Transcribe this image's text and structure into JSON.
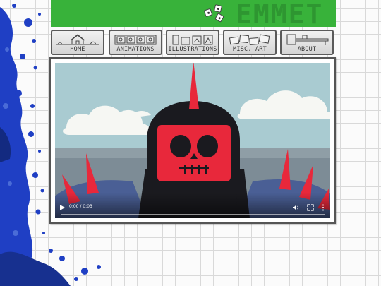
{
  "banner": {
    "title": "EMMET"
  },
  "nav": {
    "items": [
      {
        "label": "HOME",
        "icon": "house-sketch-icon"
      },
      {
        "label": "ANIMATIONS",
        "icon": "film-strip-icon"
      },
      {
        "label": "ILLUSTRATIONS",
        "icon": "drawings-icon"
      },
      {
        "label": "MISC. ART",
        "icon": "scattered-papers-icon"
      },
      {
        "label": "ABOUT",
        "icon": "desk-icon"
      }
    ]
  },
  "video": {
    "time_display": "0:00 / 0:03",
    "progress": 0.0,
    "scene": "skull-knight-helmet",
    "controls": [
      "play-icon",
      "volume-icon",
      "fullscreen-icon",
      "more-options-icon"
    ]
  },
  "colors": {
    "banner_green": "#38b23a",
    "banner_text_green": "#2e9631",
    "splatter_blue": "#1f3fc4",
    "skull_red": "#e8283b",
    "sky": "#a9cbd1"
  }
}
